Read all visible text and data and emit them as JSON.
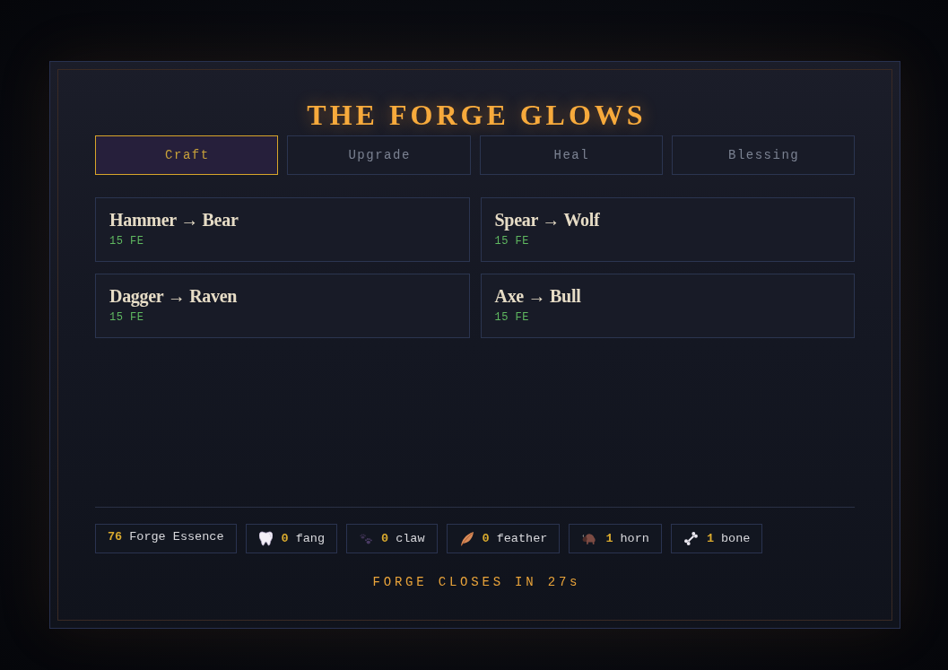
{
  "title": "THE FORGE GLOWS",
  "tabs": [
    {
      "label": "Craft",
      "selected": true
    },
    {
      "label": "Upgrade",
      "selected": false
    },
    {
      "label": "Heal",
      "selected": false
    },
    {
      "label": "Blessing",
      "selected": false
    }
  ],
  "recipes": [
    {
      "name": "Hammer → Bear",
      "cost": "15 FE"
    },
    {
      "name": "Spear → Wolf",
      "cost": "15 FE"
    },
    {
      "name": "Dagger → Raven",
      "cost": "15 FE"
    },
    {
      "name": "Axe → Bull",
      "cost": "15 FE"
    }
  ],
  "resources": [
    {
      "kind": "currency",
      "count": "76",
      "label": "Forge Essence"
    },
    {
      "kind": "material",
      "count": "0",
      "label": "fang"
    },
    {
      "kind": "material",
      "count": "0",
      "label": "claw"
    },
    {
      "kind": "material",
      "count": "0",
      "label": "feather"
    },
    {
      "kind": "material",
      "count": "1",
      "label": "horn"
    },
    {
      "kind": "material",
      "count": "1",
      "label": "bone"
    }
  ],
  "footer": "FORGE CLOSES IN 27s"
}
